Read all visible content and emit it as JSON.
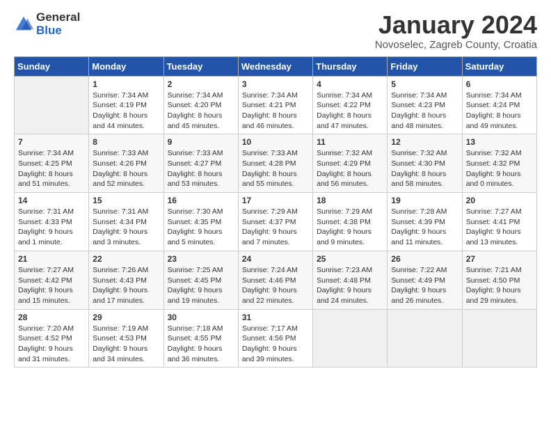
{
  "header": {
    "logo_line1": "General",
    "logo_line2": "Blue",
    "month_title": "January 2024",
    "subtitle": "Novoselec, Zagreb County, Croatia"
  },
  "weekdays": [
    "Sunday",
    "Monday",
    "Tuesday",
    "Wednesday",
    "Thursday",
    "Friday",
    "Saturday"
  ],
  "weeks": [
    [
      {
        "day": "",
        "sunrise": "",
        "sunset": "",
        "daylight": "",
        "empty": true
      },
      {
        "day": "1",
        "sunrise": "Sunrise: 7:34 AM",
        "sunset": "Sunset: 4:19 PM",
        "daylight": "Daylight: 8 hours and 44 minutes."
      },
      {
        "day": "2",
        "sunrise": "Sunrise: 7:34 AM",
        "sunset": "Sunset: 4:20 PM",
        "daylight": "Daylight: 8 hours and 45 minutes."
      },
      {
        "day": "3",
        "sunrise": "Sunrise: 7:34 AM",
        "sunset": "Sunset: 4:21 PM",
        "daylight": "Daylight: 8 hours and 46 minutes."
      },
      {
        "day": "4",
        "sunrise": "Sunrise: 7:34 AM",
        "sunset": "Sunset: 4:22 PM",
        "daylight": "Daylight: 8 hours and 47 minutes."
      },
      {
        "day": "5",
        "sunrise": "Sunrise: 7:34 AM",
        "sunset": "Sunset: 4:23 PM",
        "daylight": "Daylight: 8 hours and 48 minutes."
      },
      {
        "day": "6",
        "sunrise": "Sunrise: 7:34 AM",
        "sunset": "Sunset: 4:24 PM",
        "daylight": "Daylight: 8 hours and 49 minutes."
      }
    ],
    [
      {
        "day": "7",
        "sunrise": "Sunrise: 7:34 AM",
        "sunset": "Sunset: 4:25 PM",
        "daylight": "Daylight: 8 hours and 51 minutes."
      },
      {
        "day": "8",
        "sunrise": "Sunrise: 7:33 AM",
        "sunset": "Sunset: 4:26 PM",
        "daylight": "Daylight: 8 hours and 52 minutes."
      },
      {
        "day": "9",
        "sunrise": "Sunrise: 7:33 AM",
        "sunset": "Sunset: 4:27 PM",
        "daylight": "Daylight: 8 hours and 53 minutes."
      },
      {
        "day": "10",
        "sunrise": "Sunrise: 7:33 AM",
        "sunset": "Sunset: 4:28 PM",
        "daylight": "Daylight: 8 hours and 55 minutes."
      },
      {
        "day": "11",
        "sunrise": "Sunrise: 7:32 AM",
        "sunset": "Sunset: 4:29 PM",
        "daylight": "Daylight: 8 hours and 56 minutes."
      },
      {
        "day": "12",
        "sunrise": "Sunrise: 7:32 AM",
        "sunset": "Sunset: 4:30 PM",
        "daylight": "Daylight: 8 hours and 58 minutes."
      },
      {
        "day": "13",
        "sunrise": "Sunrise: 7:32 AM",
        "sunset": "Sunset: 4:32 PM",
        "daylight": "Daylight: 9 hours and 0 minutes."
      }
    ],
    [
      {
        "day": "14",
        "sunrise": "Sunrise: 7:31 AM",
        "sunset": "Sunset: 4:33 PM",
        "daylight": "Daylight: 9 hours and 1 minute."
      },
      {
        "day": "15",
        "sunrise": "Sunrise: 7:31 AM",
        "sunset": "Sunset: 4:34 PM",
        "daylight": "Daylight: 9 hours and 3 minutes."
      },
      {
        "day": "16",
        "sunrise": "Sunrise: 7:30 AM",
        "sunset": "Sunset: 4:35 PM",
        "daylight": "Daylight: 9 hours and 5 minutes."
      },
      {
        "day": "17",
        "sunrise": "Sunrise: 7:29 AM",
        "sunset": "Sunset: 4:37 PM",
        "daylight": "Daylight: 9 hours and 7 minutes."
      },
      {
        "day": "18",
        "sunrise": "Sunrise: 7:29 AM",
        "sunset": "Sunset: 4:38 PM",
        "daylight": "Daylight: 9 hours and 9 minutes."
      },
      {
        "day": "19",
        "sunrise": "Sunrise: 7:28 AM",
        "sunset": "Sunset: 4:39 PM",
        "daylight": "Daylight: 9 hours and 11 minutes."
      },
      {
        "day": "20",
        "sunrise": "Sunrise: 7:27 AM",
        "sunset": "Sunset: 4:41 PM",
        "daylight": "Daylight: 9 hours and 13 minutes."
      }
    ],
    [
      {
        "day": "21",
        "sunrise": "Sunrise: 7:27 AM",
        "sunset": "Sunset: 4:42 PM",
        "daylight": "Daylight: 9 hours and 15 minutes."
      },
      {
        "day": "22",
        "sunrise": "Sunrise: 7:26 AM",
        "sunset": "Sunset: 4:43 PM",
        "daylight": "Daylight: 9 hours and 17 minutes."
      },
      {
        "day": "23",
        "sunrise": "Sunrise: 7:25 AM",
        "sunset": "Sunset: 4:45 PM",
        "daylight": "Daylight: 9 hours and 19 minutes."
      },
      {
        "day": "24",
        "sunrise": "Sunrise: 7:24 AM",
        "sunset": "Sunset: 4:46 PM",
        "daylight": "Daylight: 9 hours and 22 minutes."
      },
      {
        "day": "25",
        "sunrise": "Sunrise: 7:23 AM",
        "sunset": "Sunset: 4:48 PM",
        "daylight": "Daylight: 9 hours and 24 minutes."
      },
      {
        "day": "26",
        "sunrise": "Sunrise: 7:22 AM",
        "sunset": "Sunset: 4:49 PM",
        "daylight": "Daylight: 9 hours and 26 minutes."
      },
      {
        "day": "27",
        "sunrise": "Sunrise: 7:21 AM",
        "sunset": "Sunset: 4:50 PM",
        "daylight": "Daylight: 9 hours and 29 minutes."
      }
    ],
    [
      {
        "day": "28",
        "sunrise": "Sunrise: 7:20 AM",
        "sunset": "Sunset: 4:52 PM",
        "daylight": "Daylight: 9 hours and 31 minutes."
      },
      {
        "day": "29",
        "sunrise": "Sunrise: 7:19 AM",
        "sunset": "Sunset: 4:53 PM",
        "daylight": "Daylight: 9 hours and 34 minutes."
      },
      {
        "day": "30",
        "sunrise": "Sunrise: 7:18 AM",
        "sunset": "Sunset: 4:55 PM",
        "daylight": "Daylight: 9 hours and 36 minutes."
      },
      {
        "day": "31",
        "sunrise": "Sunrise: 7:17 AM",
        "sunset": "Sunset: 4:56 PM",
        "daylight": "Daylight: 9 hours and 39 minutes."
      },
      {
        "day": "",
        "empty": true
      },
      {
        "day": "",
        "empty": true
      },
      {
        "day": "",
        "empty": true
      }
    ]
  ]
}
